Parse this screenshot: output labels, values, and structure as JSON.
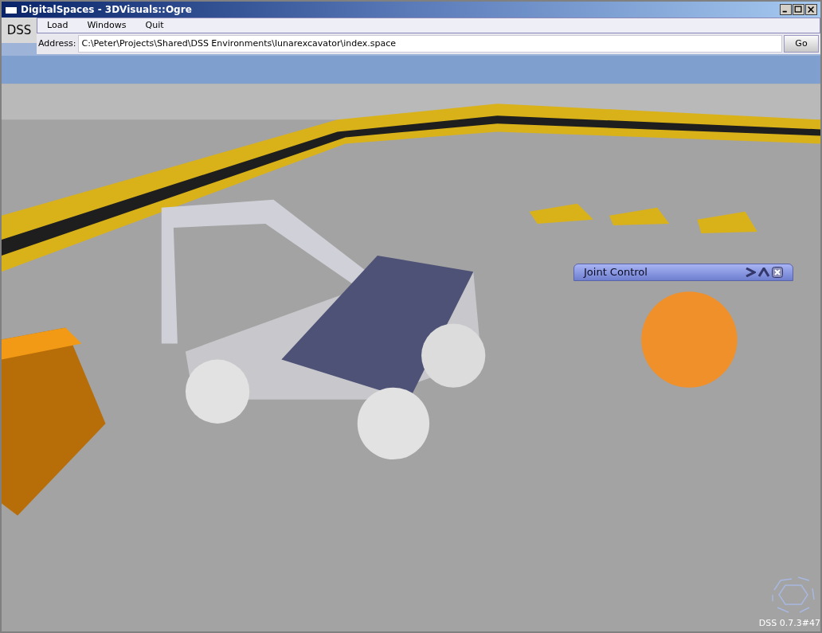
{
  "window": {
    "title": "DigitalSpaces - 3DVisuals::Ogre"
  },
  "brand": "DSS",
  "menu": [
    {
      "label": "Load"
    },
    {
      "label": "Windows"
    },
    {
      "label": "Quit"
    }
  ],
  "address": {
    "label": "Address:",
    "value": "C:\\Peter\\Projects\\Shared\\DSS Environments\\lunarexcavator\\index.space",
    "button": "Go"
  },
  "joint_control": {
    "title": "Joint Control"
  },
  "version": "DSS 0.7.3#47"
}
